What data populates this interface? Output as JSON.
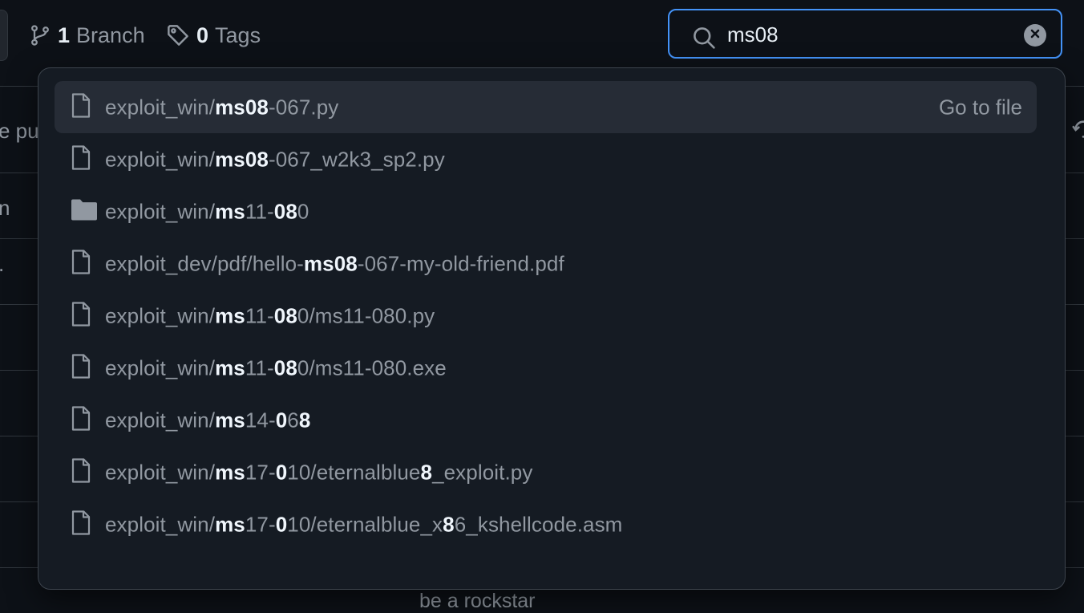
{
  "header": {
    "branch": {
      "count": "1",
      "label": "Branch"
    },
    "tags": {
      "count": "0",
      "label": "Tags"
    }
  },
  "search": {
    "value": "ms08",
    "placeholder": "Go to file"
  },
  "background": {
    "row_fragments": [
      "e pu",
      "n",
      "."
    ],
    "footer_text": "be a rockstar"
  },
  "dropdown": {
    "action_label": "Go to file",
    "results": [
      {
        "type": "file",
        "segments": [
          [
            "exploit_win/",
            false
          ],
          [
            "ms08",
            true
          ],
          [
            "-067.py",
            false
          ]
        ]
      },
      {
        "type": "file",
        "segments": [
          [
            "exploit_win/",
            false
          ],
          [
            "ms08",
            true
          ],
          [
            "-067_w2k3_sp2.py",
            false
          ]
        ]
      },
      {
        "type": "folder",
        "segments": [
          [
            "exploit_win/",
            false
          ],
          [
            "ms",
            true
          ],
          [
            "11-",
            false
          ],
          [
            "08",
            true
          ],
          [
            "0",
            false
          ]
        ]
      },
      {
        "type": "file",
        "segments": [
          [
            "exploit_dev/pdf/hello-",
            false
          ],
          [
            "ms08",
            true
          ],
          [
            "-067-my-old-friend.pdf",
            false
          ]
        ]
      },
      {
        "type": "file",
        "segments": [
          [
            "exploit_win/",
            false
          ],
          [
            "ms",
            true
          ],
          [
            "11-",
            false
          ],
          [
            "08",
            true
          ],
          [
            "0/ms11-080.py",
            false
          ]
        ]
      },
      {
        "type": "file",
        "segments": [
          [
            "exploit_win/",
            false
          ],
          [
            "ms",
            true
          ],
          [
            "11-",
            false
          ],
          [
            "08",
            true
          ],
          [
            "0/ms11-080.exe",
            false
          ]
        ]
      },
      {
        "type": "file",
        "segments": [
          [
            "exploit_win/",
            false
          ],
          [
            "ms",
            true
          ],
          [
            "14-",
            false
          ],
          [
            "0",
            true
          ],
          [
            "6",
            false
          ],
          [
            "8",
            true
          ]
        ]
      },
      {
        "type": "file",
        "segments": [
          [
            "exploit_win/",
            false
          ],
          [
            "ms",
            true
          ],
          [
            "17-",
            false
          ],
          [
            "0",
            true
          ],
          [
            "10/eternalblue",
            false
          ],
          [
            "8",
            true
          ],
          [
            "_exploit.py",
            false
          ]
        ]
      },
      {
        "type": "file",
        "segments": [
          [
            "exploit_win/",
            false
          ],
          [
            "ms",
            true
          ],
          [
            "17-",
            false
          ],
          [
            "0",
            true
          ],
          [
            "10/eternalblue_x",
            false
          ],
          [
            "8",
            true
          ],
          [
            "6_kshellcode.asm",
            false
          ]
        ]
      }
    ]
  }
}
